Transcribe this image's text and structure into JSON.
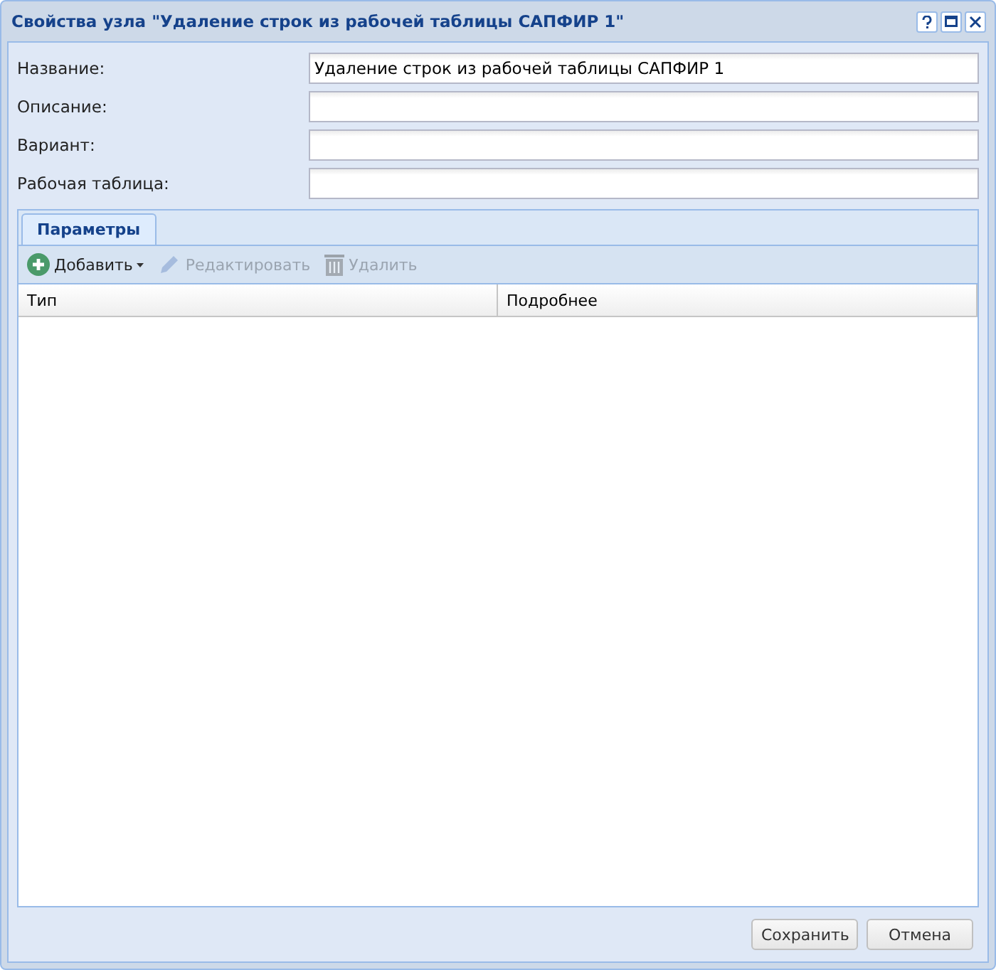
{
  "window": {
    "title": "Свойства узла \"Удаление строк из рабочей таблицы САПФИР 1\""
  },
  "fields": [
    {
      "label": "Название:",
      "value": "Удаление строк из рабочей таблицы САПФИР 1"
    },
    {
      "label": "Описание:"
    },
    {
      "label": "Вариант:"
    },
    {
      "label": "Рабочая таблица:"
    }
  ],
  "tabs": [
    {
      "label": "Параметры",
      "selected": true
    }
  ],
  "toolbar": [
    {
      "kind": "add",
      "label": "Добавить",
      "disabled": false,
      "menu": true
    },
    {
      "kind": "edit",
      "label": "Редактировать",
      "disabled": true,
      "menu": false
    },
    {
      "kind": "delete",
      "label": "Удалить",
      "disabled": true,
      "menu": false
    }
  ],
  "table": {
    "columns": [
      "Тип",
      "Подробнее"
    ]
  },
  "buttons": [
    "Сохранить",
    "Отмена"
  ]
}
